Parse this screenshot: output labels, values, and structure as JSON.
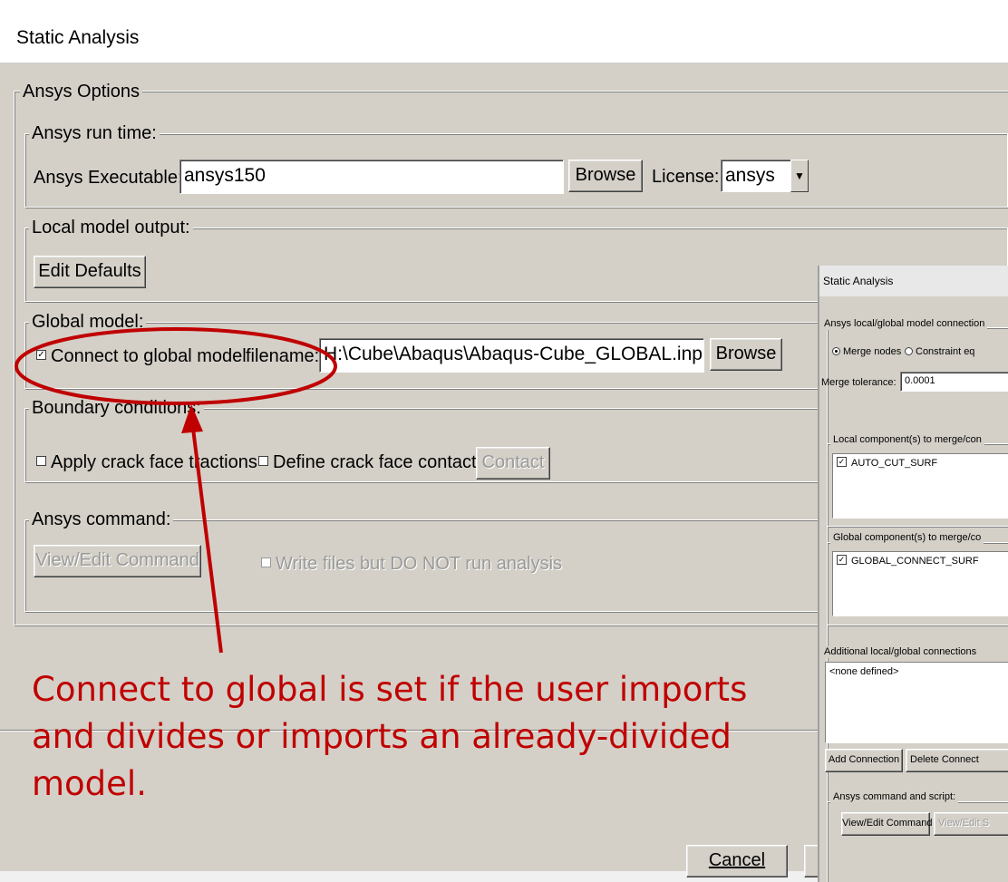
{
  "window": {
    "title": "Static Analysis"
  },
  "ansys_options": {
    "group_title": "Ansys Options",
    "run_time": {
      "title": "Ansys run time:",
      "executable_label": "Ansys Executable:",
      "executable_value": "ansys150",
      "browse_label": "Browse",
      "license_label": "License:",
      "license_value": "ansys"
    },
    "local_output": {
      "title": "Local model output:",
      "edit_defaults_label": "Edit Defaults"
    },
    "global_model": {
      "title": "Global model:",
      "connect_label": "Connect to global model",
      "connect_checked": true,
      "filename_label": "filename:",
      "filename_value": "H:\\Cube\\Abaqus\\Abaqus-Cube_GLOBAL.inp",
      "browse_label": "Browse"
    },
    "boundary_conditions": {
      "title": "Boundary conditions:",
      "traction_label": "Apply crack face tractions",
      "contact_label": "Define crack face contact",
      "contact_button": "Contact"
    },
    "command": {
      "title": "Ansys command:",
      "view_edit_label": "View/Edit Command",
      "write_only_label": "Write files but DO NOT run analysis"
    }
  },
  "footer": {
    "cancel_label": "Cancel"
  },
  "annotation": {
    "text": "Connect to global is set if the user imports and divides or imports an already-divided model.",
    "color": "#c00000"
  },
  "secondary_dialog": {
    "title": "Static Analysis",
    "connections_group": "Ansys local/global model connection",
    "merge_nodes_label": "Merge nodes",
    "constraint_label": "Constraint eq",
    "merge_tolerance_label": "Merge tolerance:",
    "merge_tolerance_value": "0.0001",
    "local_group": "Local component(s) to merge/con",
    "local_item": "AUTO_CUT_SURF",
    "global_group": "Global component(s) to merge/co",
    "global_item": "GLOBAL_CONNECT_SURF",
    "additional_group": "Additional local/global connections",
    "additional_item": "<none defined>",
    "add_connection_label": "Add Connection",
    "delete_connection_label": "Delete Connect",
    "script_group": "Ansys command and script:",
    "view_edit_command_label": "View/Edit Command",
    "view_edit_script_label": "View/Edit S"
  }
}
